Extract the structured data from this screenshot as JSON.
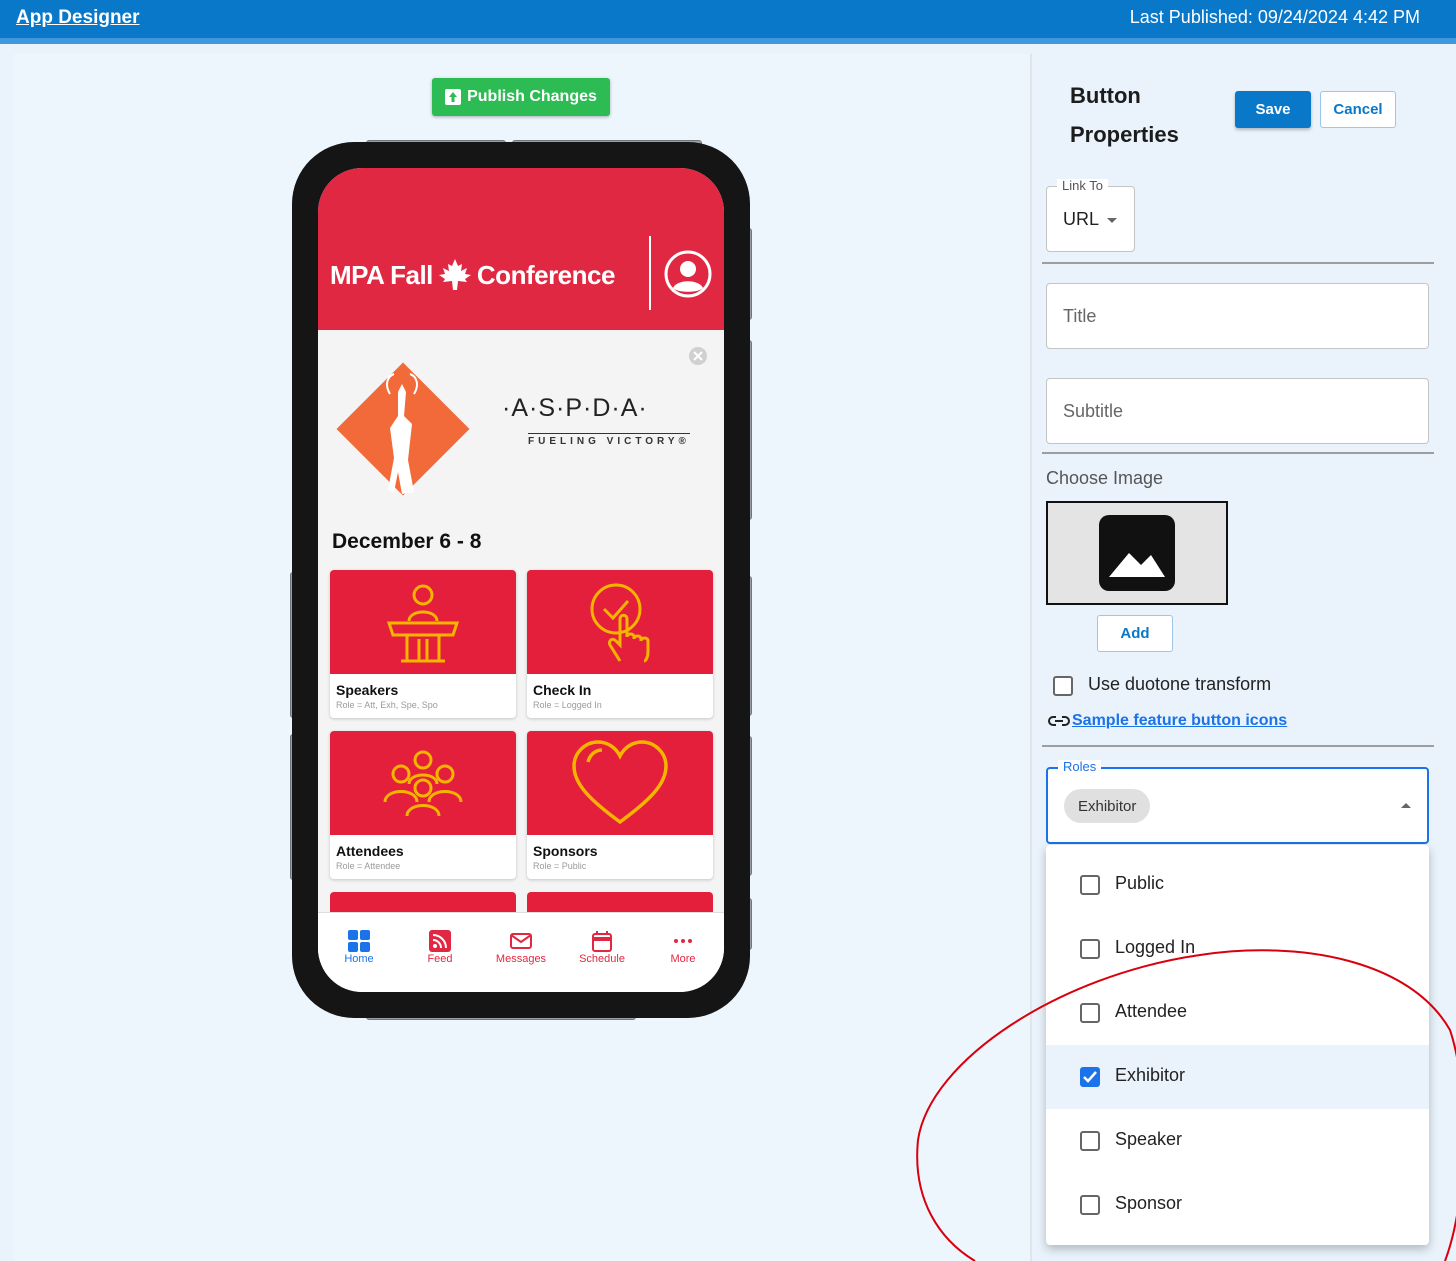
{
  "topbar": {
    "brand": "App Designer",
    "last_published": "Last Published: 09/24/2024 4:42 PM"
  },
  "canvas": {
    "publish_label": "Publish Changes"
  },
  "app": {
    "title_part1": "MPA Fall",
    "title_part2": "Conference",
    "sponsor_name": "·A·S·P·D·A·",
    "sponsor_tagline": "FUELING VICTORY®",
    "date_heading": "December 6 - 8",
    "cards": [
      {
        "title": "Speakers",
        "role": "Role = Att, Exh, Spe, Spo"
      },
      {
        "title": "Check In",
        "role": "Role = Logged In"
      },
      {
        "title": "Attendees",
        "role": "Role = Attendee"
      },
      {
        "title": "Sponsors",
        "role": "Role = Public"
      }
    ],
    "tabs": [
      {
        "label": "Home",
        "icon": "grid-icon"
      },
      {
        "label": "Feed",
        "icon": "rss-icon"
      },
      {
        "label": "Messages",
        "icon": "envelope-icon"
      },
      {
        "label": "Schedule",
        "icon": "calendar-icon"
      },
      {
        "label": "More",
        "icon": "ellipsis-icon"
      }
    ]
  },
  "panel": {
    "title": "Button Properties",
    "save_label": "Save",
    "cancel_label": "Cancel",
    "link_to": {
      "label": "Link To",
      "value": "URL"
    },
    "title_placeholder": "Title",
    "subtitle_placeholder": "Subtitle",
    "choose_image_label": "Choose Image",
    "add_label": "Add",
    "duotone_label": "Use duotone transform",
    "sample_link_label": "Sample feature button icons",
    "roles": {
      "label": "Roles",
      "chip": "Exhibitor",
      "options": [
        {
          "label": "Public",
          "checked": false
        },
        {
          "label": "Logged In",
          "checked": false
        },
        {
          "label": "Attendee",
          "checked": false
        },
        {
          "label": "Exhibitor",
          "checked": true
        },
        {
          "label": "Speaker",
          "checked": false
        },
        {
          "label": "Sponsor",
          "checked": false
        }
      ]
    }
  },
  "colors": {
    "brand_blue": "#0a78c9",
    "publish_green": "#2dbc54",
    "app_red": "#e12842",
    "icon_gold": "#f5b400",
    "annotation_red": "#d9000d"
  }
}
